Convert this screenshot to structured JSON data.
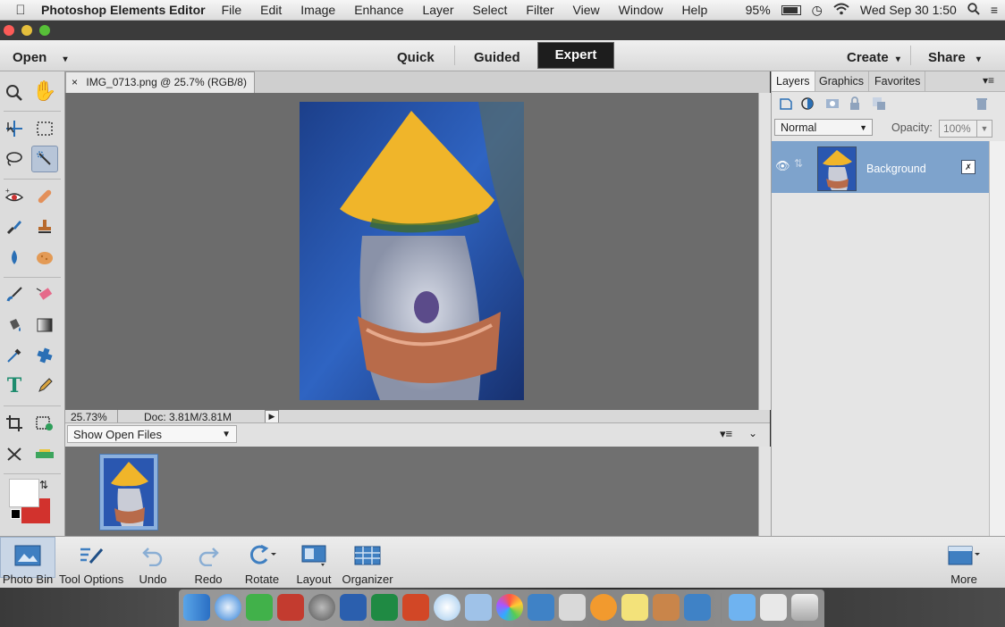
{
  "menubar": {
    "app_name": "Photoshop Elements Editor",
    "items": [
      "File",
      "Edit",
      "Image",
      "Enhance",
      "Layer",
      "Select",
      "Filter",
      "View",
      "Window",
      "Help"
    ],
    "battery": "95%",
    "clock": "Wed Sep 30  1:50"
  },
  "modebar": {
    "open_label": "Open",
    "modes": {
      "quick": "Quick",
      "guided": "Guided",
      "expert": "Expert"
    },
    "create_label": "Create",
    "share_label": "Share"
  },
  "document": {
    "tab_title": "IMG_0713.png @ 25.7% (RGB/8)",
    "close_glyph": "×",
    "zoom": "25.73%",
    "doc_size": "Doc: 3.81M/3.81M"
  },
  "photo_bin": {
    "dropdown_value": "Show Open Files"
  },
  "layers_panel": {
    "tabs": [
      "Layers",
      "Graphics",
      "Favorites"
    ],
    "blend_mode": "Normal",
    "opacity_label": "Opacity:",
    "opacity_value": "100%",
    "layer_name": "Background"
  },
  "taskbar": {
    "photo_bin": "Photo Bin",
    "tool_options": "Tool Options",
    "undo": "Undo",
    "redo": "Redo",
    "rotate": "Rotate",
    "layout": "Layout",
    "organizer": "Organizer",
    "more": "More"
  },
  "colors": {
    "accent_blue": "#2a6fb5",
    "selected_layer": "#7ea3cc",
    "background_color": "#d2322d",
    "foreground_color": "#ffffff"
  }
}
